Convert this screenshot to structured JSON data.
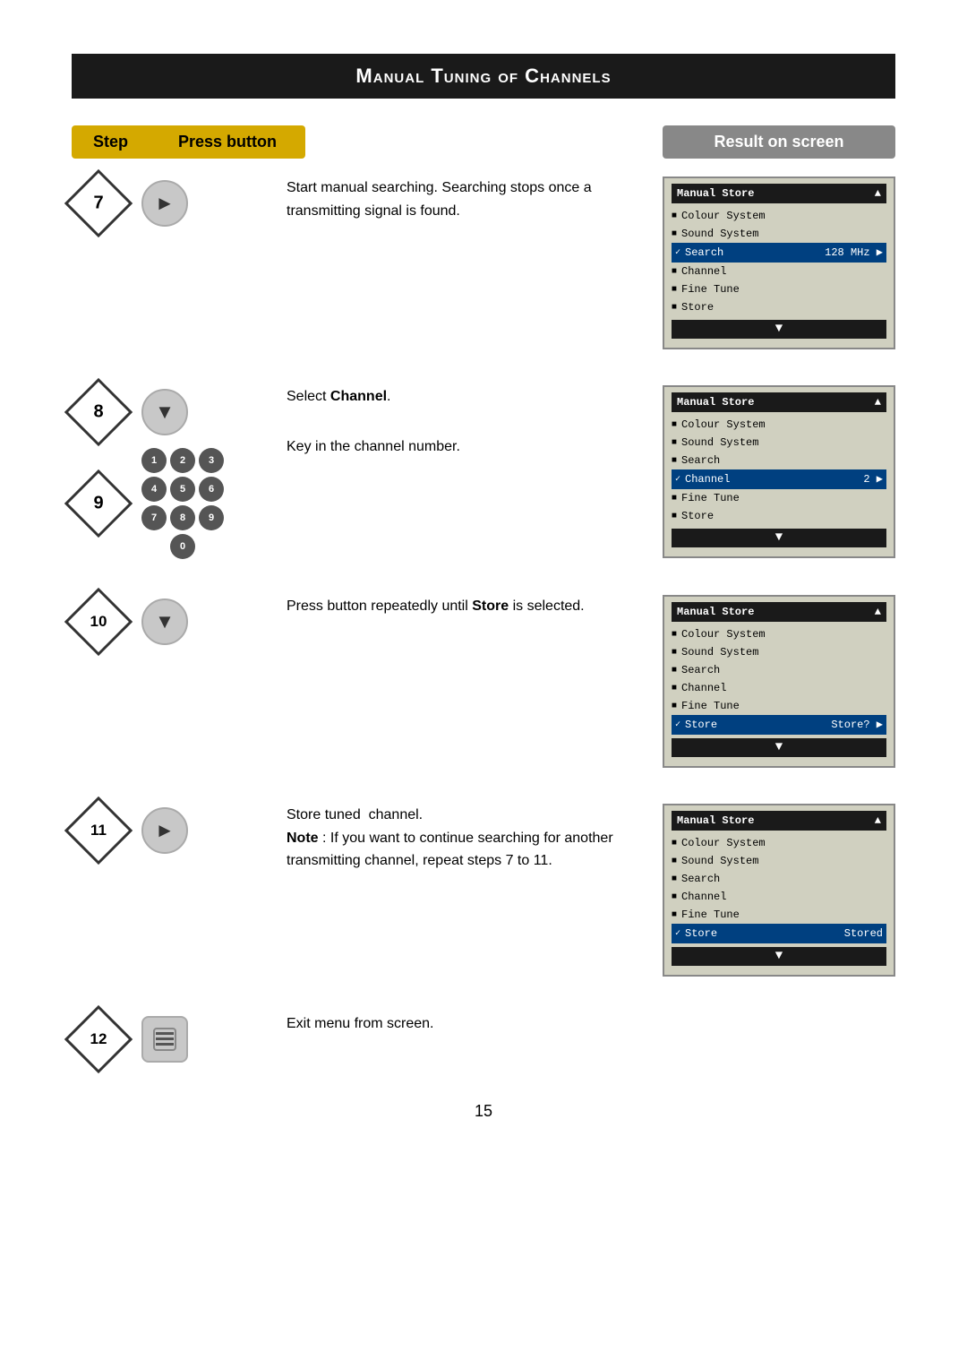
{
  "page": {
    "title": "Manual Tuning of Channels",
    "header": {
      "step_label": "Step",
      "press_label": "Press button",
      "result_label": "Result on screen"
    },
    "steps": [
      {
        "id": "7",
        "button": "right-arrow",
        "description": "Start manual searching. Searching stops once a transmitting signal is found.",
        "screen": {
          "title": "Manual Store",
          "title_arrow": "▲",
          "items": [
            {
              "bullet": "■",
              "text": "Colour System",
              "active": false,
              "value": ""
            },
            {
              "bullet": "■",
              "text": "Sound System",
              "active": false,
              "value": ""
            },
            {
              "bullet": "✓",
              "text": "Search",
              "active": true,
              "value": "128 MHz ▶"
            },
            {
              "bullet": "■",
              "text": "Channel",
              "active": false,
              "value": ""
            },
            {
              "bullet": "■",
              "text": "Fine Tune",
              "active": false,
              "value": ""
            },
            {
              "bullet": "■",
              "text": "Store",
              "active": false,
              "value": ""
            }
          ],
          "bottom_arrow": "▼"
        }
      },
      {
        "id": "8",
        "button": "down-arrow",
        "description_8": "Select Channel.",
        "id2": "9",
        "button2": "numpad",
        "description_9": "Key in the channel number.",
        "screen": {
          "title": "Manual Store",
          "title_arrow": "▲",
          "items": [
            {
              "bullet": "■",
              "text": "Colour System",
              "active": false,
              "value": ""
            },
            {
              "bullet": "■",
              "text": "Sound System",
              "active": false,
              "value": ""
            },
            {
              "bullet": "■",
              "text": "Search",
              "active": false,
              "value": ""
            },
            {
              "bullet": "✓",
              "text": "Channel",
              "active": true,
              "value": "2 ▶"
            },
            {
              "bullet": "■",
              "text": "Fine Tune",
              "active": false,
              "value": ""
            },
            {
              "bullet": "■",
              "text": "Store",
              "active": false,
              "value": ""
            }
          ],
          "bottom_arrow": "▼"
        }
      },
      {
        "id": "10",
        "button": "down-arrow",
        "description": "Press button repeatedly until Store is selected.",
        "screen": {
          "title": "Manual Store",
          "title_arrow": "▲",
          "items": [
            {
              "bullet": "■",
              "text": "Colour System",
              "active": false,
              "value": ""
            },
            {
              "bullet": "■",
              "text": "Sound System",
              "active": false,
              "value": ""
            },
            {
              "bullet": "■",
              "text": "Search",
              "active": false,
              "value": ""
            },
            {
              "bullet": "■",
              "text": "Channel",
              "active": false,
              "value": ""
            },
            {
              "bullet": "■",
              "text": "Fine Tune",
              "active": false,
              "value": ""
            },
            {
              "bullet": "✓",
              "text": "Store",
              "active": true,
              "value": "Store? ▶"
            }
          ],
          "bottom_arrow": "▼"
        }
      },
      {
        "id": "11",
        "button": "right-arrow",
        "description": "Store tuned  channel.\nNote : If you want to continue searching for another transmitting channel, repeat steps 7 to 11.",
        "screen": {
          "title": "Manual Store",
          "title_arrow": "▲",
          "items": [
            {
              "bullet": "■",
              "text": "Colour System",
              "active": false,
              "value": ""
            },
            {
              "bullet": "■",
              "text": "Sound System",
              "active": false,
              "value": ""
            },
            {
              "bullet": "■",
              "text": "Search",
              "active": false,
              "value": ""
            },
            {
              "bullet": "■",
              "text": "Channel",
              "active": false,
              "value": ""
            },
            {
              "bullet": "■",
              "text": "Fine Tune",
              "active": false,
              "value": ""
            },
            {
              "bullet": "✓",
              "text": "Store",
              "active": true,
              "value": "Stored"
            }
          ],
          "bottom_arrow": "▼"
        }
      },
      {
        "id": "12",
        "button": "menu-icon",
        "description": "Exit menu from screen.",
        "screen": null
      }
    ],
    "page_number": "15"
  }
}
